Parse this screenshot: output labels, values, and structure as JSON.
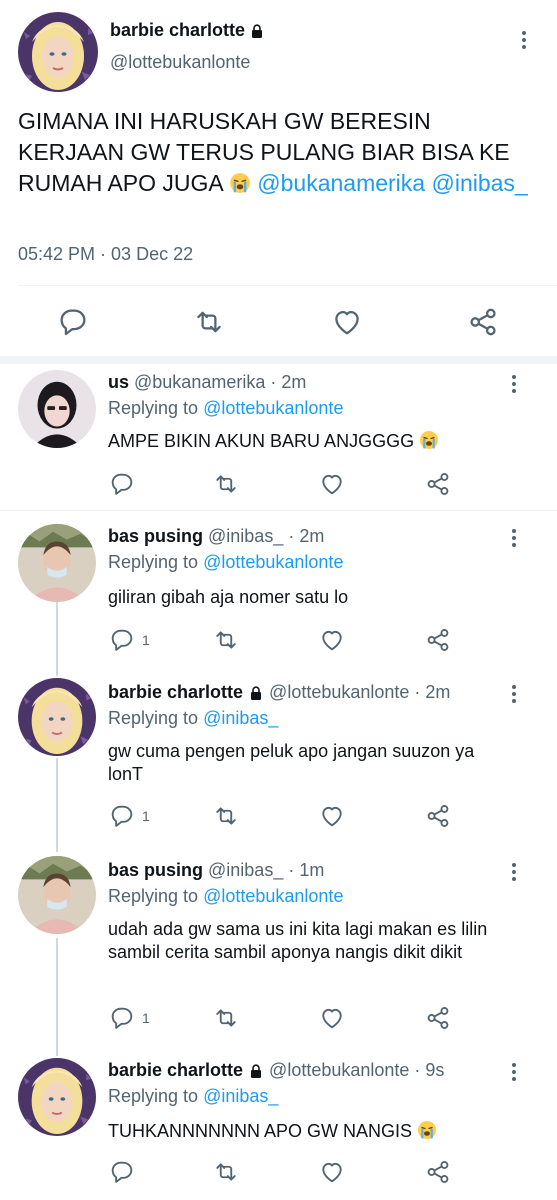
{
  "main_tweet": {
    "name": "barbie charlotte",
    "handle": "@lottebukanlonte",
    "text": "GIMANA INI HARUSKAH GW BERESIN KERJAAN GW TERUS PULANG BIAR BISA KE RUMAH APO JUGA",
    "mention_1": "@bukanamerika",
    "mention_2": "@inibas_",
    "timestamp": "05:42 PM · 03 Dec 22",
    "icons": [
      "reply-icon",
      "retweet-icon",
      "like-icon",
      "share-icon"
    ]
  },
  "replies": [
    {
      "name": "us",
      "handle": "@bukanamerika",
      "age": "· 2m",
      "replying_label": "Replying to",
      "replying_to": "@lottebukanlonte",
      "text": "AMPE BIKIN AKUN BARU ANJGGGG",
      "reply_count": "",
      "locked": false
    },
    {
      "name": "bas pusing",
      "handle": "@inibas_",
      "age": "· 2m",
      "replying_label": "Replying to",
      "replying_to": "@lottebukanlonte",
      "text": "giliran gibah aja nomer satu lo",
      "reply_count": "1",
      "locked": false
    },
    {
      "name": "barbie charlotte",
      "handle": "@lottebukanlonte",
      "age": "· 2m",
      "replying_label": "Replying to",
      "replying_to": "@inibas_",
      "text": "gw cuma pengen peluk apo jangan suuzon ya lonT",
      "reply_count": "1",
      "locked": true
    },
    {
      "name": "bas pusing",
      "handle": "@inibas_",
      "age": "· 1m",
      "replying_label": "Replying to",
      "replying_to": "@lottebukanlonte",
      "text": "udah ada gw sama us ini kita lagi makan es lilin sambil cerita sambil aponya nangis dikit dikit",
      "reply_count": "1",
      "locked": false
    },
    {
      "name": "barbie charlotte",
      "handle": "@lottebukanlonte",
      "age": "· 9s",
      "replying_label": "Replying to",
      "replying_to": "@inibas_",
      "text": "TUHKANNNNNNN APO GW NANGIS",
      "reply_count": "",
      "locked": true
    }
  ],
  "colors": {
    "accent": "#1d9bf0",
    "text": "#0f1419",
    "muted": "#536471",
    "separator": "#eff3f4"
  }
}
